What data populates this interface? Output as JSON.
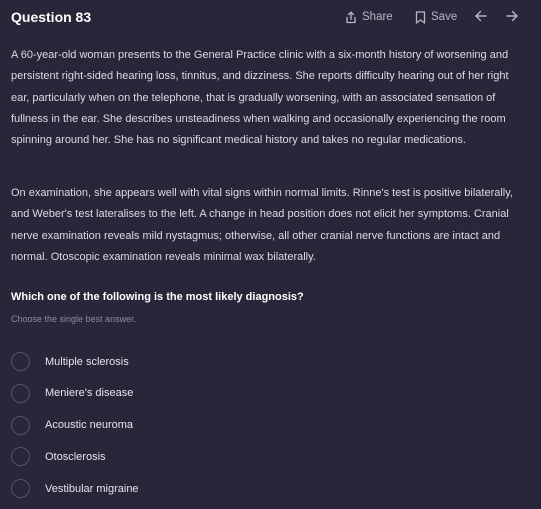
{
  "header": {
    "title": "Question 83",
    "share_label": "Share",
    "save_label": "Save"
  },
  "stem": {
    "paragraph1": "A 60-year-old woman presents to the General Practice clinic with a six-month history of worsening and persistent right-sided hearing loss, tinnitus, and dizziness. She reports difficulty hearing out of her right ear, particularly when on the telephone, that is gradually worsening, with an associated sensation of fullness in the ear. She describes unsteadiness when walking and occasionally experiencing the room spinning around her. She has no significant medical history and takes no regular medications.",
    "paragraph2": "On examination, she appears well with vital signs within normal limits. Rinne's test is positive bilaterally, and Weber's test lateralises to the left. A change in head position does not elicit her symptoms. Cranial nerve examination reveals mild nystagmus; otherwise, all other cranial nerve functions are intact and normal. Otoscopic examination reveals minimal wax bilaterally."
  },
  "question": {
    "prompt": "Which one of the following is the most likely diagnosis?",
    "instruction": "Choose the single best answer."
  },
  "options": [
    {
      "label": "Multiple sclerosis"
    },
    {
      "label": "Meniere's disease"
    },
    {
      "label": "Acoustic neuroma"
    },
    {
      "label": "Otosclerosis"
    },
    {
      "label": "Vestibular migraine"
    }
  ],
  "icons": {
    "share": "share-icon",
    "save": "bookmark-icon",
    "prev": "arrow-left-icon",
    "next": "arrow-right-icon"
  },
  "colors": {
    "background": "#282638",
    "text": "#dcdbe6",
    "muted": "#8f8ca3",
    "radio_border": "#55526a"
  }
}
